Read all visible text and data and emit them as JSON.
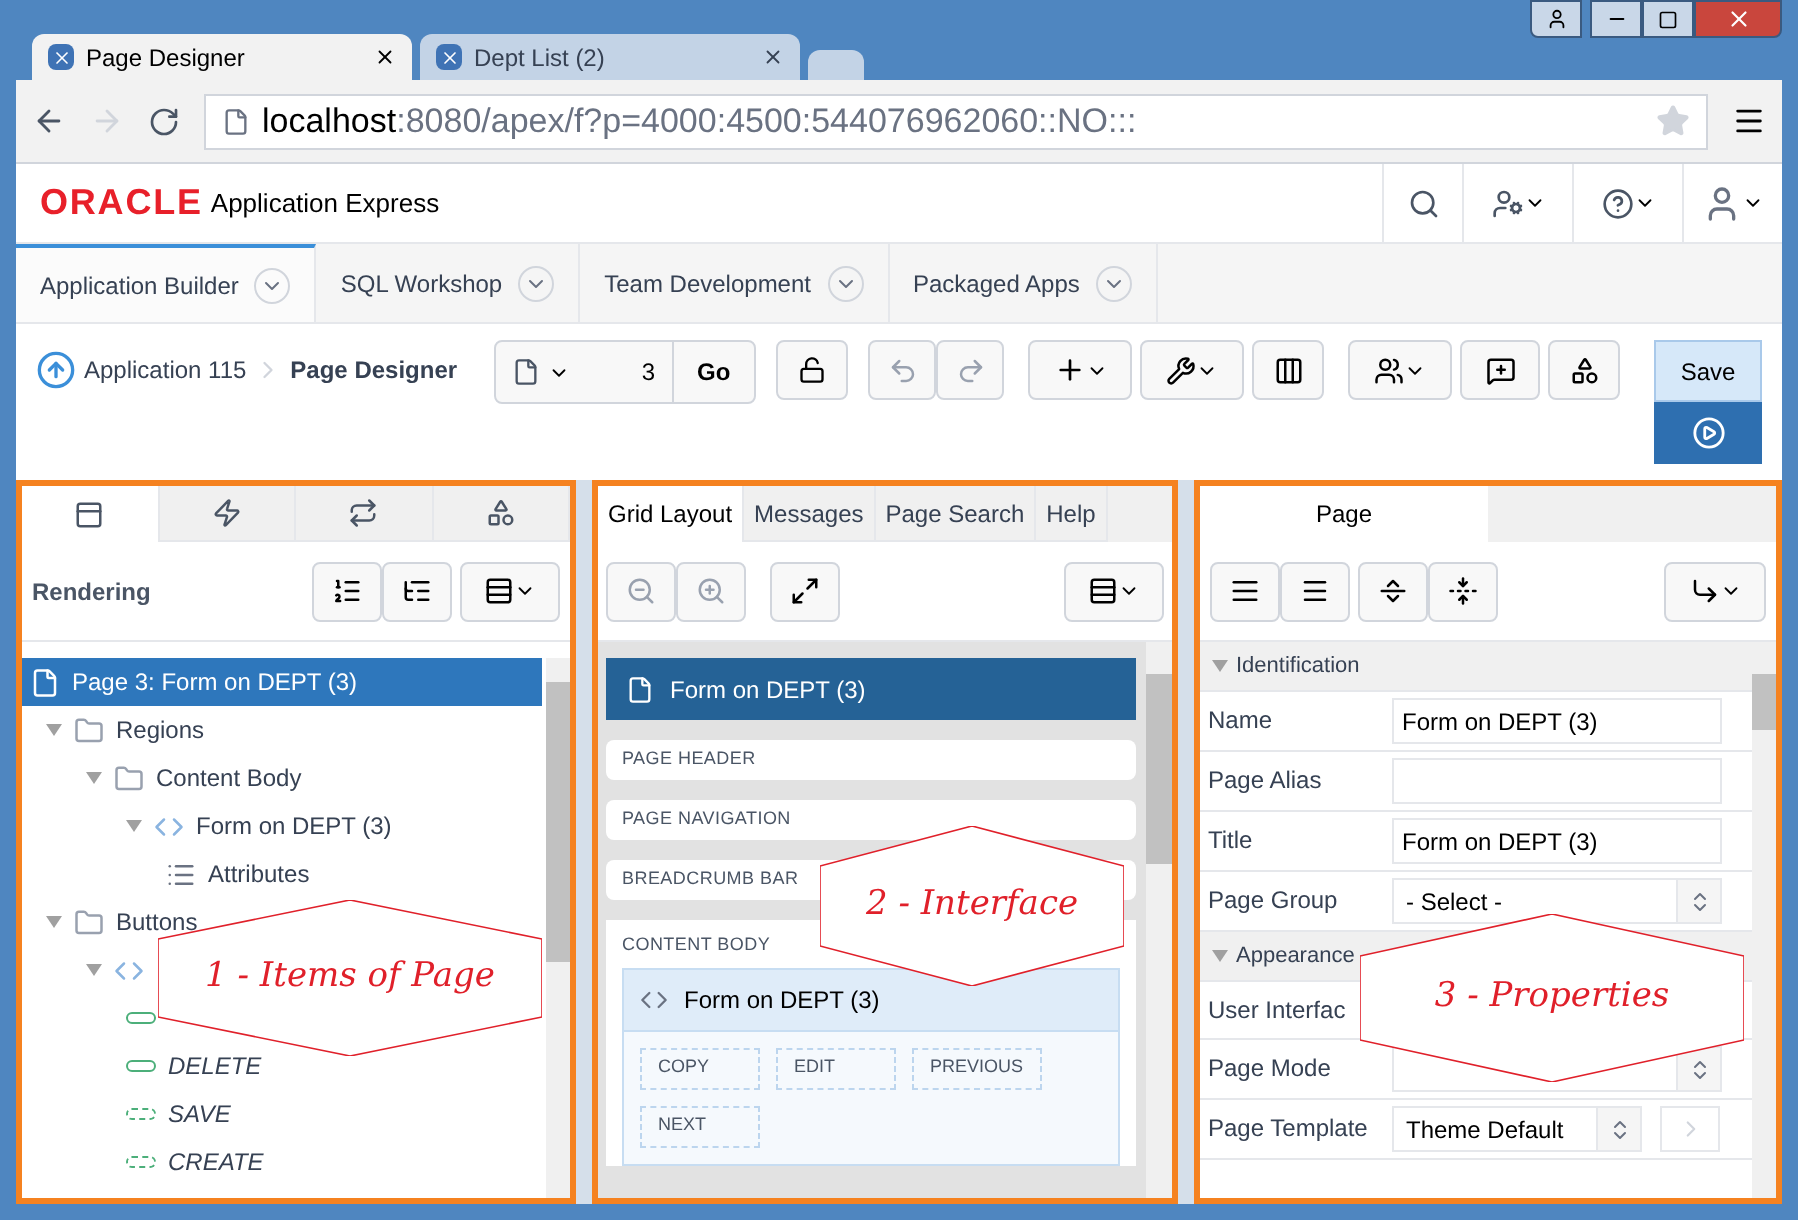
{
  "browser": {
    "tabs": [
      {
        "title": "Page Designer",
        "selected": true
      },
      {
        "title": "Dept List (2)",
        "selected": false
      }
    ],
    "url_host": "localhost",
    "url_rest": ":8080/apex/f?p=4000:4500:544076962060::NO:::"
  },
  "header": {
    "brand": "ORACLE",
    "product": "Application Express"
  },
  "nav_tabs": [
    {
      "label": "Application Builder",
      "selected": true
    },
    {
      "label": "SQL Workshop",
      "selected": false
    },
    {
      "label": "Team Development",
      "selected": false
    },
    {
      "label": "Packaged Apps",
      "selected": false
    }
  ],
  "toolbar": {
    "breadcrumb": [
      "Application 115",
      "Page Designer"
    ],
    "page_number": "3",
    "go": "Go",
    "save": "Save"
  },
  "left_panel": {
    "tabs": [
      {
        "kind": "rendering",
        "selected": true
      },
      {
        "kind": "dynamic-actions",
        "selected": false
      },
      {
        "kind": "processing",
        "selected": false
      },
      {
        "kind": "shared",
        "selected": false
      }
    ],
    "title": "Rendering",
    "tree": [
      {
        "label": "Page 3: Form on DEPT (3)",
        "kind": "page",
        "selected": true,
        "children": [
          {
            "label": "Regions",
            "kind": "folder",
            "expanded": true,
            "children": [
              {
                "label": "Content Body",
                "kind": "folder",
                "expanded": true,
                "children": [
                  {
                    "label": "Form on DEPT (3)",
                    "kind": "region",
                    "expanded": true,
                    "children": [
                      {
                        "label": "Attributes",
                        "kind": "attributes"
                      }
                    ]
                  }
                ]
              }
            ]
          },
          {
            "label": "Buttons",
            "kind": "folder",
            "expanded": true,
            "children": [
              {
                "kind": "region",
                "expanded": true,
                "children": [
                  {
                    "kind": "button"
                  },
                  {
                    "label": "DELETE",
                    "kind": "button"
                  },
                  {
                    "label": "SAVE",
                    "kind": "conditional-button"
                  },
                  {
                    "label": "CREATE",
                    "kind": "conditional-button"
                  }
                ]
              }
            ]
          }
        ]
      }
    ]
  },
  "middle_panel": {
    "tabs": [
      {
        "label": "Grid Layout",
        "selected": true
      },
      {
        "label": "Messages",
        "selected": false
      },
      {
        "label": "Page Search",
        "selected": false
      },
      {
        "label": "Help",
        "selected": false
      }
    ],
    "page_title": "Form on DEPT (3)",
    "positions": [
      "PAGE HEADER",
      "PAGE NAVIGATION",
      "BREADCRUMB BAR"
    ],
    "content_body": {
      "label": "CONTENT BODY",
      "region_title": "Form on DEPT (3)",
      "buttons": [
        "COPY",
        "EDIT",
        "PREVIOUS",
        "NEXT"
      ]
    }
  },
  "right_panel": {
    "tab": {
      "label": "Page",
      "selected": true
    },
    "sections": [
      {
        "title": "Identification",
        "expanded": true,
        "rows": [
          {
            "label": "Name",
            "kind": "text",
            "value": "Form on DEPT (3)"
          },
          {
            "label": "Page Alias",
            "kind": "text"
          },
          {
            "label": "Title",
            "kind": "text",
            "value": "Form on DEPT (3)"
          },
          {
            "label": "Page Group",
            "kind": "select",
            "value": "- Select -"
          }
        ]
      },
      {
        "title": "Appearance",
        "expanded": true,
        "rows": [
          {
            "label": "User Interfac",
            "kind": "covered"
          },
          {
            "label": "Page Mode",
            "kind": "select"
          },
          {
            "label": "Page Template",
            "kind": "select-link",
            "value": "Theme Default"
          }
        ]
      }
    ]
  },
  "annotations": [
    "1 - Items of Page",
    "2 - Interface",
    "3 - Properties"
  ]
}
